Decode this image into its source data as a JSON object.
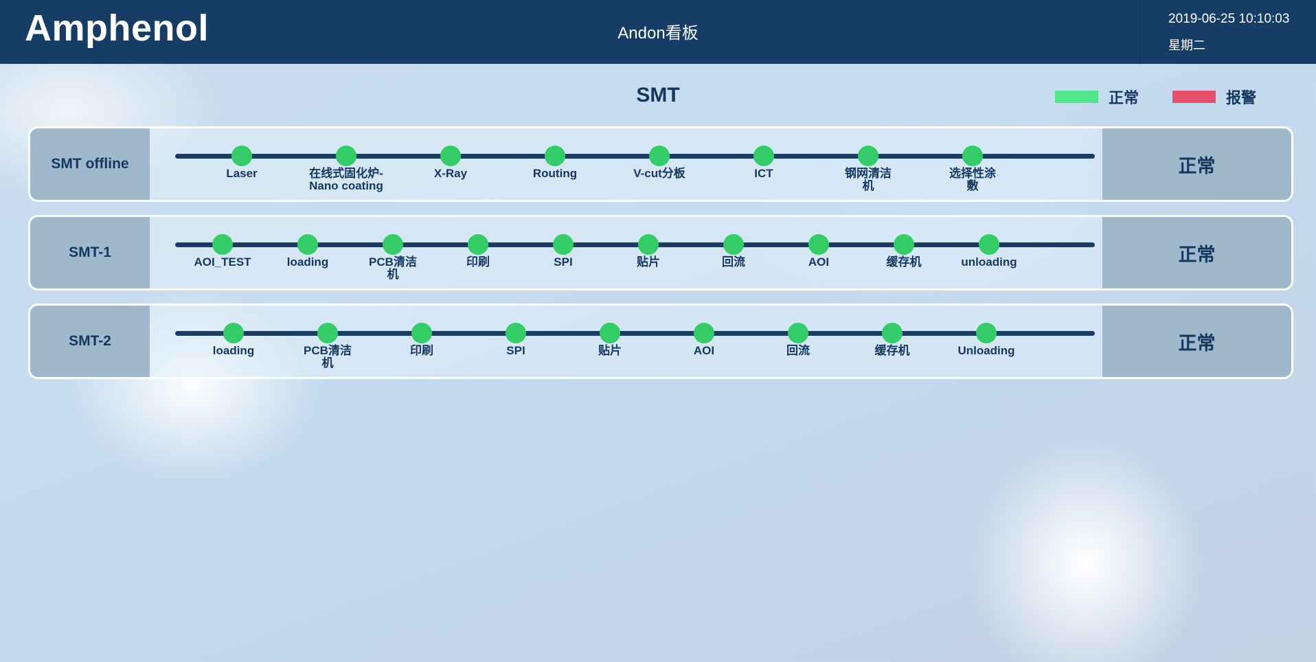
{
  "header": {
    "logo": "Amphenol",
    "title": "Andon看板",
    "datetime": "2019-06-25 10:10:03",
    "weekday": "星期二"
  },
  "section_title": "SMT",
  "legend": [
    {
      "label": "正常",
      "color": "#52e68c"
    },
    {
      "label": "报警",
      "color": "#e8516a"
    }
  ],
  "lines": [
    {
      "name": "SMT offline",
      "status": "正常",
      "stations": [
        "Laser",
        "在线式固化炉-Nano coating",
        "X-Ray",
        "Routing",
        "V-cut分板",
        "ICT",
        "钢网清洁机",
        "选择性涂敷"
      ]
    },
    {
      "name": "SMT-1",
      "status": "正常",
      "stations": [
        "AOI_TEST",
        "loading",
        "PCB清洁机",
        "印刷",
        "SPI",
        "贴片",
        "回流",
        "AOI",
        "缓存机",
        "unloading"
      ]
    },
    {
      "name": "SMT-2",
      "status": "正常",
      "stations": [
        "loading",
        "PCB清洁机",
        "印刷",
        "SPI",
        "贴片",
        "AOI",
        "回流",
        "缓存机",
        "Unloading"
      ]
    }
  ],
  "colors": {
    "header_bg": "#153d66",
    "station_normal": "#33cc66",
    "track": "#1b3c63"
  }
}
